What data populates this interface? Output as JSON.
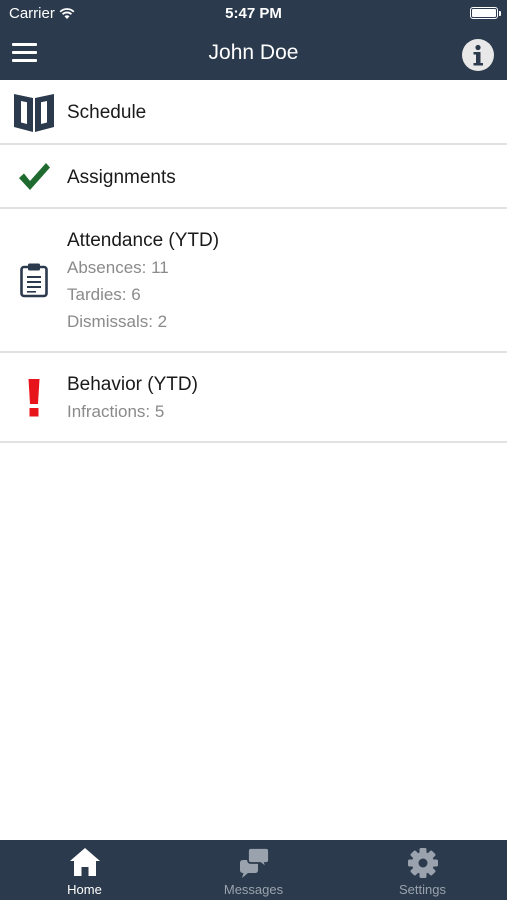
{
  "status_bar": {
    "carrier": "Carrier",
    "time": "5:47 PM"
  },
  "nav": {
    "title": "John Doe"
  },
  "list": {
    "schedule": {
      "title": "Schedule"
    },
    "assignments": {
      "title": "Assignments"
    },
    "attendance": {
      "title": "Attendance (YTD)",
      "absences": "Absences: 11",
      "tardies": "Tardies: 6",
      "dismissals": "Dismissals: 2"
    },
    "behavior": {
      "title": "Behavior (YTD)",
      "infractions": "Infractions: 5"
    }
  },
  "tabs": [
    {
      "label": "Home",
      "icon": "home-icon",
      "active": true
    },
    {
      "label": "Messages",
      "icon": "chat-bubbles-icon",
      "active": false
    },
    {
      "label": "Settings",
      "icon": "gear-icon",
      "active": false
    }
  ],
  "colors": {
    "bar_background": "#2b3a4c",
    "check_green": "#1f6b2f",
    "alert_red": "#e8141b",
    "inactive_tab": "#9aa3ad"
  }
}
